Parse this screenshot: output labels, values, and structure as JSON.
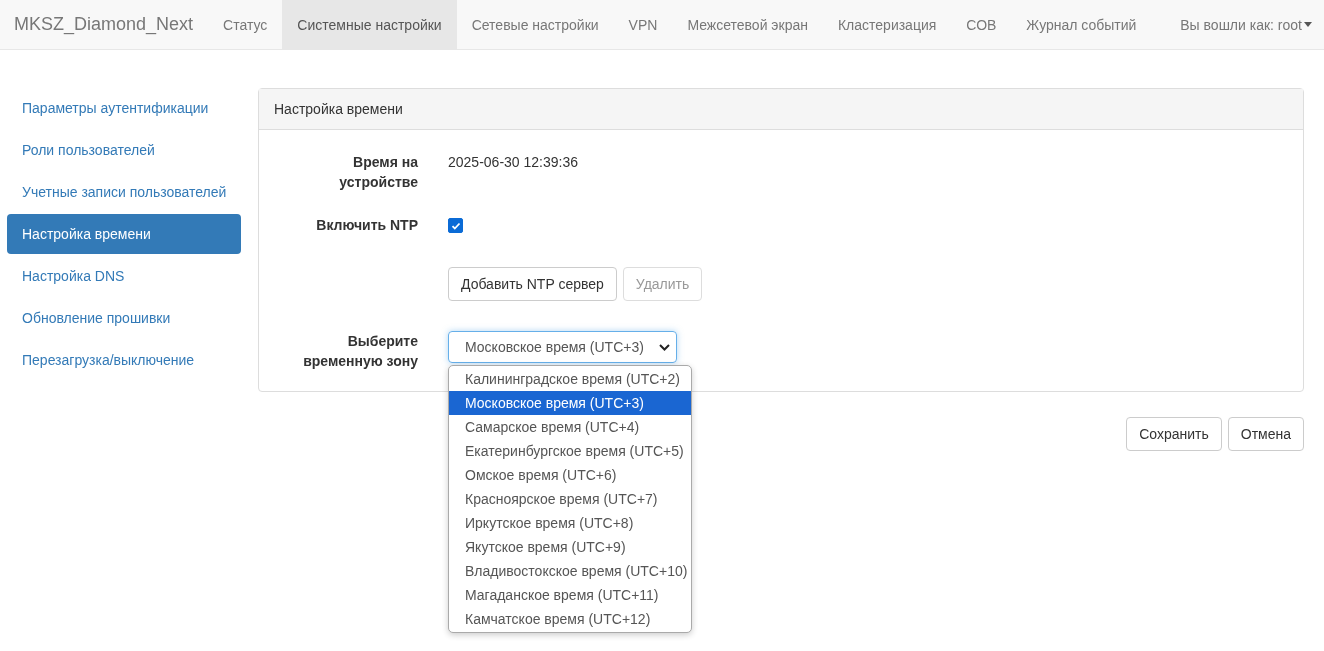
{
  "navbar": {
    "brand": "MKSZ_Diamond_Next",
    "items": [
      {
        "label": "Статус",
        "selected": false
      },
      {
        "label": "Системные настройки",
        "selected": true
      },
      {
        "label": "Сетевые настройки",
        "selected": false
      },
      {
        "label": "VPN",
        "selected": false
      },
      {
        "label": "Межсетевой экран",
        "selected": false
      },
      {
        "label": "Кластеризация",
        "selected": false
      },
      {
        "label": "СОВ",
        "selected": false
      },
      {
        "label": "Журнал событий",
        "selected": false
      }
    ],
    "user_menu": "Вы вошли как: root"
  },
  "sidebar": {
    "items": [
      {
        "label": "Параметры аутентификации",
        "selected": false
      },
      {
        "label": "Роли пользователей",
        "selected": false
      },
      {
        "label": "Учетные записи пользователей",
        "selected": false
      },
      {
        "label": "Настройка времени",
        "selected": true
      },
      {
        "label": "Настройка DNS",
        "selected": false
      },
      {
        "label": "Обновление прошивки",
        "selected": false
      },
      {
        "label": "Перезагрузка/выключение",
        "selected": false
      }
    ]
  },
  "panel": {
    "title": "Настройка времени",
    "device_time": {
      "label": "Время на устройстве",
      "value": "2025-06-30 12:39:36"
    },
    "ntp": {
      "label": "Включить NTP",
      "checked": true
    },
    "ntp_buttons": [
      {
        "label": "Добавить NTP сервер",
        "disabled": false
      },
      {
        "label": "Удалить",
        "disabled": true
      }
    ],
    "timezone": {
      "label": "Выберите временную зону",
      "value": "Московское время (UTC+3)",
      "expanded": true,
      "options": [
        {
          "label": "Калининградское время (UTC+2)",
          "selected": false
        },
        {
          "label": "Московское время (UTC+3)",
          "selected": true
        },
        {
          "label": "Самарское время (UTC+4)",
          "selected": false
        },
        {
          "label": "Екатеринбургское время (UTC+5)",
          "selected": false
        },
        {
          "label": "Омское время (UTC+6)",
          "selected": false
        },
        {
          "label": "Красноярское время (UTC+7)",
          "selected": false
        },
        {
          "label": "Иркутское время (UTC+8)",
          "selected": false
        },
        {
          "label": "Якутское время (UTC+9)",
          "selected": false
        },
        {
          "label": "Владивостокское время (UTC+10)",
          "selected": false
        },
        {
          "label": "Магаданское время (UTC+11)",
          "selected": false
        },
        {
          "label": "Камчатское время (UTC+12)",
          "selected": false
        }
      ]
    }
  },
  "footer_buttons": [
    "Сохранить",
    "Отмена"
  ]
}
